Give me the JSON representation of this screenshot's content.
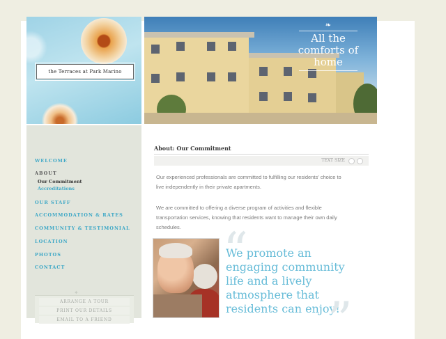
{
  "logo": {
    "name": "the Terraces at Park Marino"
  },
  "hero": {
    "tagline": "All the comforts of home",
    "ornament": "❧"
  },
  "nav": {
    "items": [
      {
        "label": "WELCOME"
      },
      {
        "label": "ABOUT"
      },
      {
        "label": "OUR STAFF"
      },
      {
        "label": "ACCOMMODATION & RATES"
      },
      {
        "label": "COMMUNITY & TESTIMONIAL"
      },
      {
        "label": "LOCATION"
      },
      {
        "label": "PHOTOS"
      },
      {
        "label": "CONTACT"
      }
    ],
    "sub_items": [
      {
        "label": "Our Commitment"
      },
      {
        "label": "Accreditations"
      }
    ]
  },
  "actions": {
    "arrange": "ARRANGE A TOUR",
    "print": "PRINT OUR DETAILS",
    "email": "EMAIL TO A FRIEND"
  },
  "main": {
    "title": "About: Our Commitment",
    "text_size_label": "TEXT SIZE",
    "paragraph_1": "Our experienced professionals are committed to fulfilling our residents' choice to live independently in their private apartments.",
    "paragraph_2": "We are committed to offering a diverse program of activities and flexible transportation services, knowing that residents want to manage their own daily schedules.",
    "quote": "We promote an engaging community life and a lively atmosphere that residents can enjoy!"
  },
  "colors": {
    "accent": "#3ca7c6",
    "quote": "#67bcd8",
    "sidebar_bg": "#e2e5dc",
    "page_bg": "#efeee2"
  }
}
